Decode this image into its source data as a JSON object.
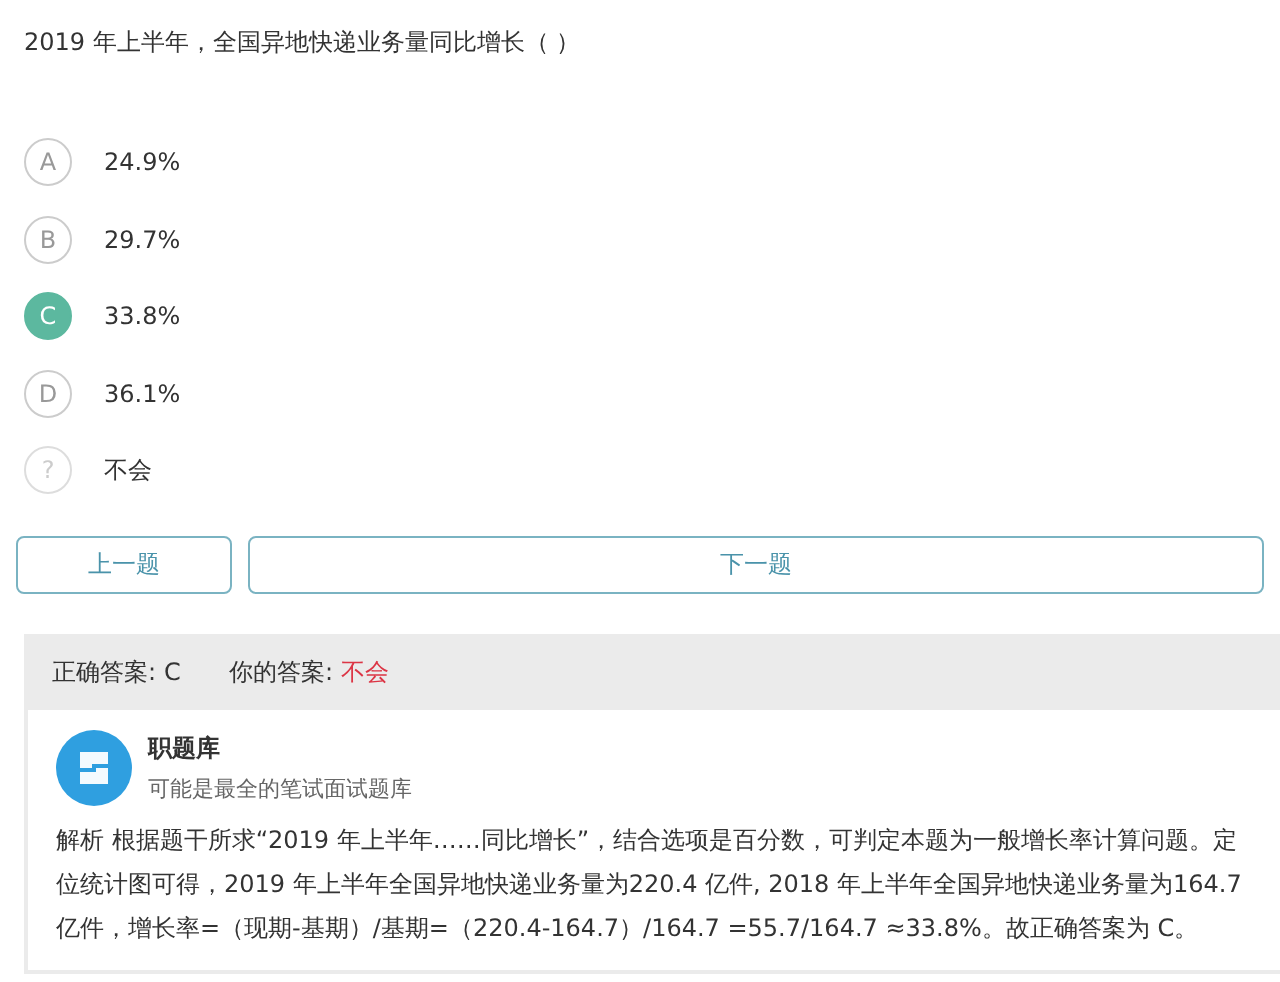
{
  "question": "2019 年上半年，全国异地快递业务量同比增长（ ）",
  "options": [
    {
      "letter": "A",
      "text": "24.9%",
      "selected": false,
      "kind": "choice"
    },
    {
      "letter": "B",
      "text": "29.7%",
      "selected": false,
      "kind": "choice"
    },
    {
      "letter": "C",
      "text": "33.8%",
      "selected": true,
      "kind": "choice"
    },
    {
      "letter": "D",
      "text": "36.1%",
      "selected": false,
      "kind": "choice"
    },
    {
      "letter": "?",
      "text": "不会",
      "selected": false,
      "kind": "unknown"
    }
  ],
  "buttons": {
    "prev": "上一题",
    "next": "下一题"
  },
  "result": {
    "correct_label": "正确答案:",
    "correct_value": "C",
    "yours_label": "你的答案:",
    "yours_value": "不会"
  },
  "source": {
    "name": "职题库",
    "tagline": "可能是最全的笔试面试题库"
  },
  "analysis": "解析 根据题干所求“2019 年上半年……同比增长”，结合选项是百分数，可判定本题为一般增长率计算问题。定位统计图可得，2019 年上半年全国异地快递业务量为220.4 亿件, 2018 年上半年全国异地快递业务量为164.7亿件，增长率=（现期-基期）/基期=（220.4-164.7）/164.7 =55.7/164.7 ≈33.8%。故正确答案为 C。"
}
